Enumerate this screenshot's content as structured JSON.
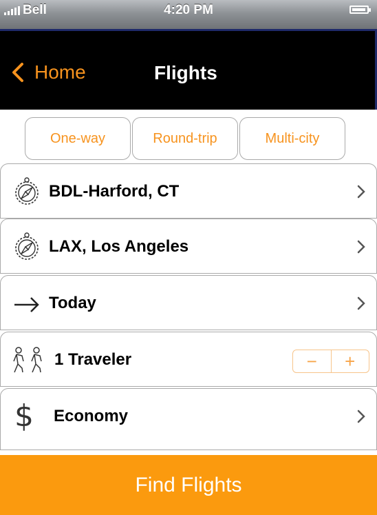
{
  "status_bar": {
    "carrier": "Bell",
    "time": "4:20 PM",
    "battery_level": 0.8
  },
  "nav": {
    "back_label": "Home",
    "title": "Flights"
  },
  "trip_types": [
    "One-way",
    "Round-trip",
    "Multi-city"
  ],
  "rows": {
    "origin": "BDL-Harford, CT",
    "destination": "LAX, Los Angeles",
    "date": "Today",
    "travelers": "1 Traveler",
    "cabin": "Economy"
  },
  "stepper": {
    "minus": "−",
    "plus": "+"
  },
  "cabin_symbol": "$",
  "find_button": "Find Flights",
  "colors": {
    "accent": "#f7931e",
    "button": "#fb9a0e",
    "navbar": "#000000"
  }
}
